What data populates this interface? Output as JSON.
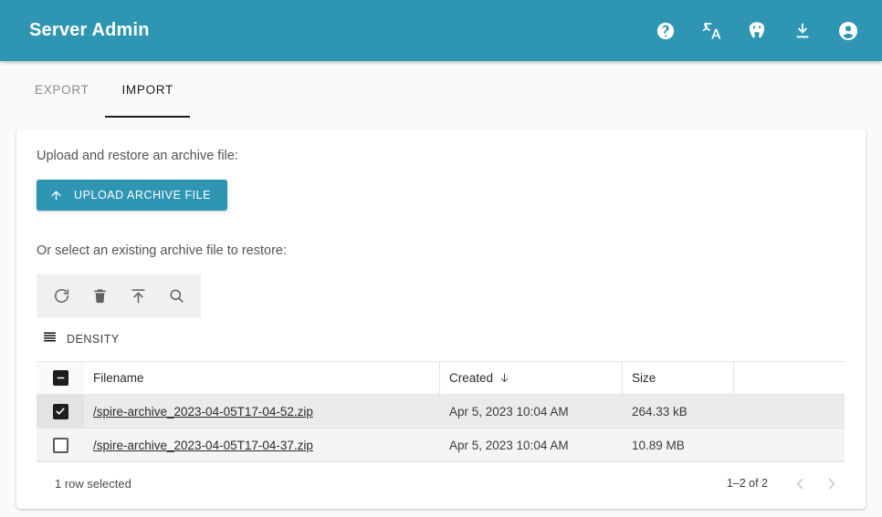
{
  "appbar": {
    "title": "Server Admin",
    "accent_color": "#2e96b2",
    "actions": [
      {
        "name": "help-icon",
        "label": "Help"
      },
      {
        "name": "translate-icon",
        "label": "Language"
      },
      {
        "name": "postgresql-icon",
        "label": "PostgreSQL"
      },
      {
        "name": "download-icon",
        "label": "Download"
      },
      {
        "name": "account-icon",
        "label": "Account"
      }
    ]
  },
  "tabs": [
    {
      "label": "EXPORT",
      "active": false
    },
    {
      "label": "IMPORT",
      "active": true
    }
  ],
  "main": {
    "upload_heading": "Upload and restore an archive file:",
    "upload_button": "UPLOAD ARCHIVE FILE",
    "select_heading": "Or select an existing archive file to restore:",
    "toolbar": [
      {
        "name": "refresh-icon",
        "label": "Refresh"
      },
      {
        "name": "delete-icon",
        "label": "Delete"
      },
      {
        "name": "restore-upload-icon",
        "label": "Restore"
      },
      {
        "name": "search-icon",
        "label": "Search"
      }
    ],
    "density_label": "DENSITY"
  },
  "table": {
    "header_checkbox_state": "indeterminate",
    "columns": [
      {
        "key": "filename",
        "label": "Filename",
        "sort": ""
      },
      {
        "key": "created",
        "label": "Created",
        "sort": "desc"
      },
      {
        "key": "size",
        "label": "Size",
        "sort": ""
      }
    ],
    "rows": [
      {
        "selected": true,
        "filename": "/spire-archive_2023-04-05T17-04-52.zip",
        "created": "Apr 5, 2023 10:04 AM",
        "size": "264.33 kB"
      },
      {
        "selected": false,
        "filename": "/spire-archive_2023-04-05T17-04-37.zip",
        "created": "Apr 5, 2023 10:04 AM",
        "size": "10.89 MB"
      }
    ],
    "footer": {
      "selection_text": "1 row selected",
      "range_text": "1–2 of 2",
      "prev_label": "Previous page",
      "next_label": "Next page"
    }
  }
}
